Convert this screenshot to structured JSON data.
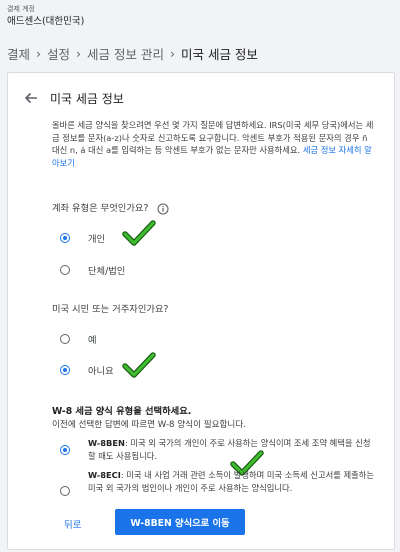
{
  "account": {
    "label": "결제 계정",
    "name": "애드센스(대한민국)"
  },
  "breadcrumb": [
    "결제",
    "설정",
    "세금 정보 관리",
    "미국 세금 정보"
  ],
  "card": {
    "title": "미국 세금 정보",
    "intro": "올바른 세금 양식을 찾으려면 우선 몇 가지 질문에 답변하세요. IRS(미국 세무 당국)에서는 세금 정보를 문자(a-z)나 숫자로 신고하도록 요구합니다. 악센트 부호가 적용된 문자의 경우 ñ 대신 n, á 대신 a를 입력하는 등 악센트 부호가 없는 문자만 사용하세요.",
    "intro_link": "세금 정보 자세히 알아보기"
  },
  "q1": {
    "label": "계좌 유형은 무엇인가요?",
    "options": [
      {
        "label": "개인",
        "selected": true
      },
      {
        "label": "단체/법인",
        "selected": false
      }
    ]
  },
  "q2": {
    "label": "미국 시민 또는 거주자인가요?",
    "options": [
      {
        "label": "예",
        "selected": false
      },
      {
        "label": "아니요",
        "selected": true
      }
    ]
  },
  "w8": {
    "title": "W-8 세금 양식 유형을 선택하세요.",
    "subtitle": "이전에 선택한 답변에 따르면 W-8 양식이 필요합니다.",
    "options": [
      {
        "name": "W-8BEN",
        "desc": ": 미국 외 국가의 개인이 주로 사용하는 양식이며 조세 조약 혜택을 신청할 때도 사용됩니다.",
        "selected": true
      },
      {
        "name": "W-8ECI",
        "desc": ": 미국 내 사업 거래 관련 소득이 발생하며 미국 소득세 신고서를 제출하는 미국 외 국가의 법인이나 개인이 주로 사용하는 양식입니다.",
        "selected": false
      }
    ]
  },
  "actions": {
    "back": "뒤로",
    "continue": "W-8BEN 양식으로 이동"
  },
  "colors": {
    "accent": "#1a73e8",
    "checkmark": "#3fbf2f"
  },
  "icons": [
    "back-arrow-icon",
    "info-icon",
    "checkmark-icon"
  ]
}
